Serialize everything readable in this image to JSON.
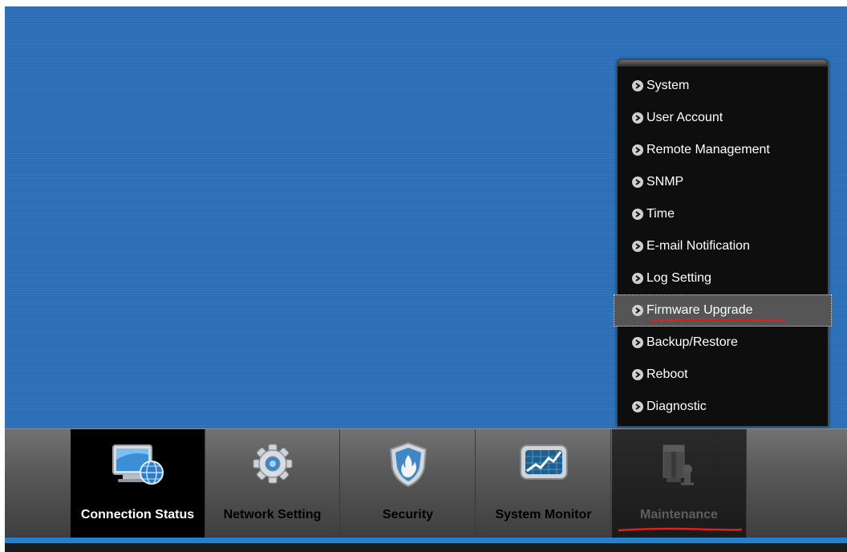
{
  "menu": {
    "items": [
      {
        "label": "System"
      },
      {
        "label": "User Account"
      },
      {
        "label": "Remote Management"
      },
      {
        "label": "SNMP"
      },
      {
        "label": "Time"
      },
      {
        "label": "E-mail Notification"
      },
      {
        "label": "Log Setting"
      },
      {
        "label": "Firmware Upgrade",
        "active": true
      },
      {
        "label": "Backup/Restore"
      },
      {
        "label": "Reboot"
      },
      {
        "label": "Diagnostic"
      }
    ]
  },
  "nav": {
    "items": [
      {
        "label": "Connection Status",
        "icon": "monitor-globe-icon",
        "state": "selected"
      },
      {
        "label": "Network Setting",
        "icon": "gear-icon",
        "state": "normal"
      },
      {
        "label": "Security",
        "icon": "shield-fire-icon",
        "state": "normal"
      },
      {
        "label": "System Monitor",
        "icon": "chart-monitor-icon",
        "state": "normal"
      },
      {
        "label": "Maintenance",
        "icon": "maintenance-tools-icon",
        "state": "open"
      }
    ]
  },
  "colors": {
    "desktop": "#2c6fb7",
    "annotation": "#e02020",
    "accent_stripe": "#2a7fc4"
  }
}
